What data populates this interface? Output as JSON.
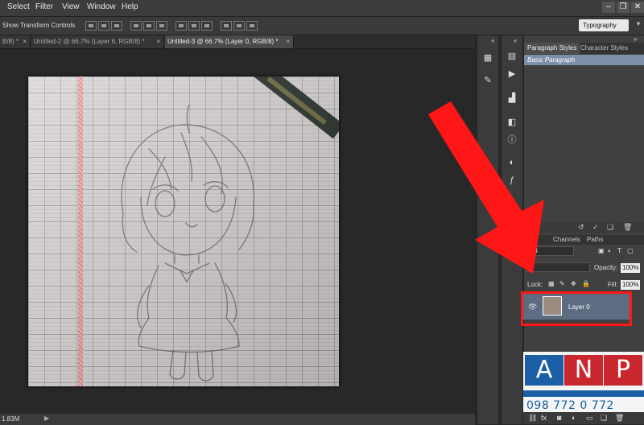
{
  "menu": [
    "Select",
    "Filter",
    "View",
    "Window",
    "Help"
  ],
  "options_bar": {
    "show_transform_label": "Show Transform Controls",
    "workspace": "Typography"
  },
  "tabs": [
    {
      "label": "B/8) *",
      "close": "×"
    },
    {
      "label": "Untitled-2 @ 66.7% (Layer 6, RGB/8) *",
      "close": "×"
    },
    {
      "label": "Untitled-3 @ 66.7% (Layer 0, RGB/8) *",
      "close": "×"
    }
  ],
  "status": {
    "zoom": "1.83M"
  },
  "paragraph_panel": {
    "tabs": [
      "Paragraph Styles",
      "Character Styles"
    ],
    "items": [
      "Basic Paragraph"
    ]
  },
  "layers_panel": {
    "tabs": [
      "s",
      "Channels",
      "Paths"
    ],
    "kind_label": "ind",
    "blend_label": "al",
    "opacity_label": "Opacity:",
    "opacity_value": "100%",
    "lock_label": "Lock:",
    "fill_label": "Fill:",
    "fill_value": "100%",
    "layers": [
      {
        "name": "Layer 0",
        "visible": true
      }
    ]
  },
  "logo": {
    "letters": [
      "A",
      "N",
      "P"
    ],
    "colors": [
      "#1b5fa6",
      "#c8272d",
      "#c8272d"
    ],
    "phone": "098 772 0 772"
  },
  "colors": {
    "highlight": "#ff1616",
    "selection": "#5d6c83"
  }
}
